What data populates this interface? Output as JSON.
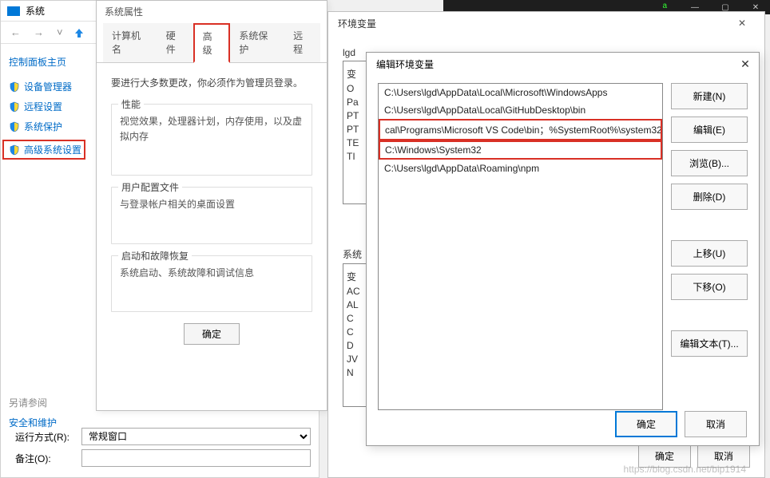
{
  "cp": {
    "title": "系统",
    "home": "控制面板主页",
    "links": [
      "设备管理器",
      "远程设置",
      "系统保护",
      "高级系统设置"
    ],
    "see_also": "另请参阅",
    "security": "安全和维护",
    "run_mode_label": "运行方式(R):",
    "run_mode_value": "常规窗口",
    "comment_label": "备注(O):"
  },
  "sp": {
    "title": "系统属性",
    "tabs": [
      "计算机名",
      "硬件",
      "高级",
      "系统保护",
      "远程"
    ],
    "active_tab": "高级",
    "note": "要进行大多数更改，你必须作为管理员登录。",
    "groups": [
      {
        "title": "性能",
        "desc": "视觉效果，处理器计划，内存使用，以及虚拟内存"
      },
      {
        "title": "用户配置文件",
        "desc": "与登录帐户相关的桌面设置"
      },
      {
        "title": "启动和故障恢复",
        "desc": "系统启动、系统故障和调试信息"
      }
    ],
    "ok": "确定"
  },
  "ev": {
    "title": "环境变量",
    "user_section": "lgd",
    "user_partial": [
      "变",
      "O",
      "Pa",
      "PT",
      "PT",
      "TE",
      "TI"
    ],
    "sys_section": "系统",
    "sys_partial": [
      "变",
      "AC",
      "AL",
      "C",
      "C",
      "D",
      "JV",
      "N"
    ],
    "ok": "确定",
    "cancel": "取消"
  },
  "edit": {
    "title": "编辑环境变量",
    "items": [
      "C:\\Users\\lgd\\AppData\\Local\\Microsoft\\WindowsApps",
      "C:\\Users\\lgd\\AppData\\Local\\GitHubDesktop\\bin",
      "cal\\Programs\\Microsoft VS Code\\bin；%SystemRoot%\\system32;",
      "C:\\Windows\\System32",
      "C:\\Users\\lgd\\AppData\\Roaming\\npm"
    ],
    "highlighted_range": [
      2,
      3
    ],
    "buttons": {
      "new": "新建(N)",
      "edit": "编辑(E)",
      "browse": "浏览(B)...",
      "delete": "删除(D)",
      "up": "上移(U)",
      "down": "下移(O)",
      "edit_text": "编辑文本(T)...",
      "ok": "确定",
      "cancel": "取消"
    }
  },
  "watermark": "https://blog.csdn.net/bip1914"
}
